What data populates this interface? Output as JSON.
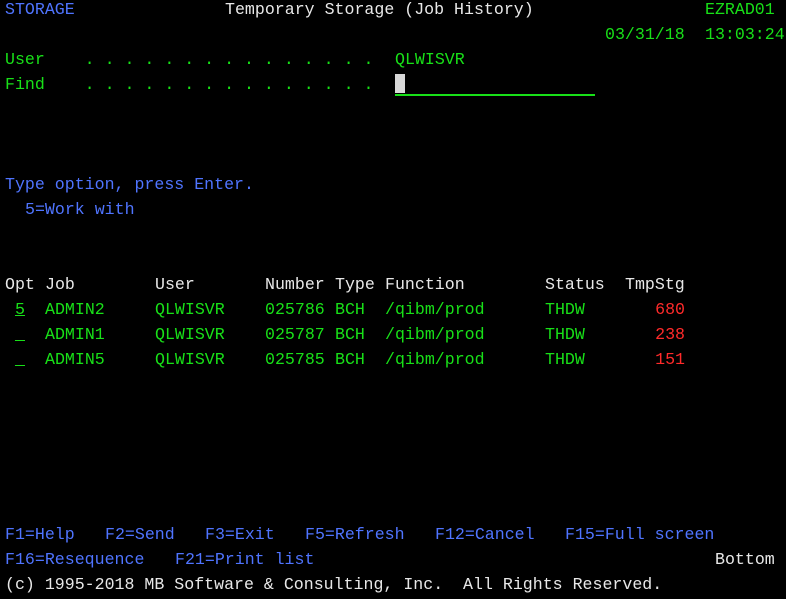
{
  "header": {
    "program": "STORAGE",
    "title": "Temporary Storage (Job History)",
    "system": "EZRAD01",
    "date": "03/31/18",
    "time": "13:03:24"
  },
  "fields": {
    "user_label": "User    . . . . . . . . . . . . . . .",
    "user_value": "QLWISVR",
    "find_label": "Find    . . . . . . . . . . . . . . .",
    "find_value": ""
  },
  "instructions": {
    "line1": "Type option, press Enter.",
    "line2": "5=Work with"
  },
  "table": {
    "headers": [
      "Opt",
      "Job",
      "User",
      "Number",
      "Type",
      "Function",
      "Status",
      "TmpStg"
    ],
    "rows": [
      {
        "opt": "5",
        "job": "ADMIN2",
        "user": "QLWISVR",
        "number": "025786",
        "type": "BCH",
        "function": "/qibm/prod",
        "status": "THDW",
        "tmpstg": "680"
      },
      {
        "opt": "_",
        "job": "ADMIN1",
        "user": "QLWISVR",
        "number": "025787",
        "type": "BCH",
        "function": "/qibm/prod",
        "status": "THDW",
        "tmpstg": "238"
      },
      {
        "opt": "_",
        "job": "ADMIN5",
        "user": "QLWISVR",
        "number": "025785",
        "type": "BCH",
        "function": "/qibm/prod",
        "status": "THDW",
        "tmpstg": "151"
      }
    ]
  },
  "fkeys": {
    "row1": [
      "F1=Help",
      "F2=Send",
      "F3=Exit",
      "F5=Refresh",
      "F12=Cancel",
      "F15=Full screen"
    ],
    "row2": [
      "F16=Resequence",
      "F21=Print list"
    ]
  },
  "scroll_indicator": "Bottom",
  "copyright": "(c) 1995-2018 MB Software & Consulting, Inc.  All Rights Reserved.",
  "colors": {
    "blue": "#4f74ff",
    "green": "#18e018",
    "white": "#e8e8e8",
    "red": "#ff2a2a"
  }
}
